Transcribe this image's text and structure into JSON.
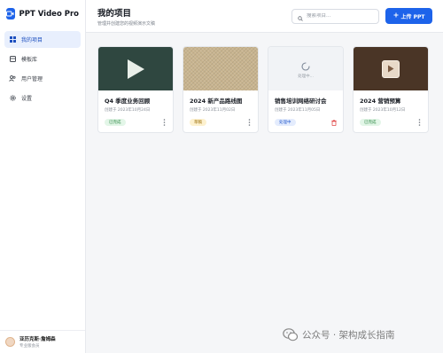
{
  "app": {
    "name": "PPT Video Pro"
  },
  "sidebar": {
    "items": [
      {
        "label": "我的项目",
        "icon": "grid-icon"
      },
      {
        "label": "模板库",
        "icon": "template-icon"
      },
      {
        "label": "用户管理",
        "icon": "users-icon"
      },
      {
        "label": "设置",
        "icon": "gear-icon"
      }
    ],
    "active_index": 0
  },
  "user": {
    "name": "亚历克斯·詹姆森",
    "role": "专业版会员"
  },
  "header": {
    "title": "我的项目",
    "subtitle": "管理并创建您的视频演示文稿",
    "search_placeholder": "搜索项目...",
    "upload_label": "上传 PPT"
  },
  "projects": [
    {
      "title": "Q4 季度业务回顾",
      "date": "创建于 2023年10月24日",
      "status": "已完成",
      "status_color": "green",
      "thumb": "play-dark"
    },
    {
      "title": "2024 新产品路线图",
      "date": "创建于 2023年11月02日",
      "status": "草稿",
      "status_color": "yellow",
      "thumb": "pattern"
    },
    {
      "title": "销售培训网络研讨会",
      "date": "创建于 2023年11月05日",
      "status": "处理中",
      "status_color": "blue",
      "thumb": "processing",
      "thumb_text": "处理中..."
    },
    {
      "title": "2024 营销预算",
      "date": "创建于 2023年10月12日",
      "status": "已完成",
      "status_color": "green",
      "thumb": "play-wood"
    }
  ],
  "watermark": {
    "text": "公众号 · 架构成长指南"
  },
  "colors": {
    "accent": "#1d63ea",
    "sidebar_active_bg": "#e8effd"
  }
}
